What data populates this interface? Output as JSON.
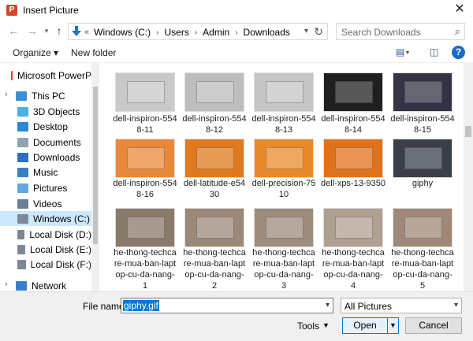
{
  "window": {
    "title": "Insert Picture",
    "app_icon_letter": "P"
  },
  "nav": {
    "back_glyph": "←",
    "forward_glyph": "→",
    "up_glyph": "↑"
  },
  "address": {
    "overflow_glyph": "«",
    "crumbs": [
      "Windows (C:)",
      "Users",
      "Admin",
      "Downloads"
    ],
    "separator": "›"
  },
  "search": {
    "placeholder": "Search Downloads"
  },
  "toolbar": {
    "organize_label": "Organize ▾",
    "new_folder_label": "New folder"
  },
  "sidebar": {
    "items": [
      {
        "label": "Microsoft PowerP",
        "icon": "powerpoint-icon",
        "color": "#d24726"
      },
      {
        "label": "This PC",
        "icon": "this-pc-icon",
        "color": "#3c8fd6"
      },
      {
        "label": "3D Objects",
        "icon": "3d-objects-icon",
        "color": "#4ab0e8"
      },
      {
        "label": "Desktop",
        "icon": "desktop-icon",
        "color": "#2b88d8"
      },
      {
        "label": "Documents",
        "icon": "documents-icon",
        "color": "#8fa3b5"
      },
      {
        "label": "Downloads",
        "icon": "downloads-icon",
        "color": "#2b6fc4"
      },
      {
        "label": "Music",
        "icon": "music-icon",
        "color": "#3a7fc7"
      },
      {
        "label": "Pictures",
        "icon": "pictures-icon",
        "color": "#5fa8e0"
      },
      {
        "label": "Videos",
        "icon": "videos-icon",
        "color": "#6b7f99"
      },
      {
        "label": "Windows (C:)",
        "icon": "drive-icon",
        "color": "#7d8896"
      },
      {
        "label": "Local Disk (D:)",
        "icon": "drive-icon",
        "color": "#7d8896"
      },
      {
        "label": "Local Disk (E:)",
        "icon": "drive-icon",
        "color": "#7d8896"
      },
      {
        "label": "Local Disk (F:)",
        "icon": "drive-icon",
        "color": "#7d8896"
      },
      {
        "label": "Network",
        "icon": "network-icon",
        "color": "#3a7fc7"
      }
    ]
  },
  "files": {
    "items": [
      {
        "name": [
          "dell-inspiron-554",
          "8-11"
        ],
        "thumb": "#c9c9c9"
      },
      {
        "name": [
          "dell-inspiron-554",
          "8-12"
        ],
        "thumb": "#bdbdbd"
      },
      {
        "name": [
          "dell-inspiron-554",
          "8-13"
        ],
        "thumb": "#c5c5c5"
      },
      {
        "name": [
          "dell-inspiron-554",
          "8-14"
        ],
        "thumb": "#1f1f1f"
      },
      {
        "name": [
          "dell-inspiron-554",
          "8-15"
        ],
        "thumb": "#333344"
      },
      {
        "name": [
          "dell-inspiron-554",
          "8-16"
        ],
        "thumb": "#e8893a"
      },
      {
        "name": [
          "dell-latitude-e54",
          "30"
        ],
        "thumb": "#e07a1f"
      },
      {
        "name": [
          "dell-precision-75",
          "10"
        ],
        "thumb": "#e88a2a"
      },
      {
        "name": [
          "dell-xps-13-9350"
        ],
        "thumb": "#e0721c"
      },
      {
        "name": [
          "giphy"
        ],
        "thumb": "#3a3f4a"
      },
      {
        "name": [
          "he-thong-techca",
          "re-mua-ban-lapt",
          "op-cu-da-nang-",
          "1"
        ],
        "thumb": "#8a7a6a"
      },
      {
        "name": [
          "he-thong-techca",
          "re-mua-ban-lapt",
          "op-cu-da-nang-",
          "2"
        ],
        "thumb": "#9a8878"
      },
      {
        "name": [
          "he-thong-techca",
          "re-mua-ban-lapt",
          "op-cu-da-nang-",
          "3"
        ],
        "thumb": "#9c8c7c"
      },
      {
        "name": [
          "he-thong-techca",
          "re-mua-ban-lapt",
          "op-cu-da-nang-",
          "4"
        ],
        "thumb": "#b0a090"
      },
      {
        "name": [
          "he-thong-techca",
          "re-mua-ban-lapt",
          "op-cu-da-nang-",
          "5"
        ],
        "thumb": "#a08878"
      }
    ]
  },
  "footer": {
    "file_name_label": "File name:",
    "file_name_value": "giphy.gif",
    "filter_value": "All Pictures",
    "tools_label": "Tools",
    "open_label": "Open",
    "cancel_label": "Cancel"
  },
  "colors": {
    "selection": "#cce8ff",
    "accent": "#0078d7",
    "help": "#1b6ac9"
  }
}
